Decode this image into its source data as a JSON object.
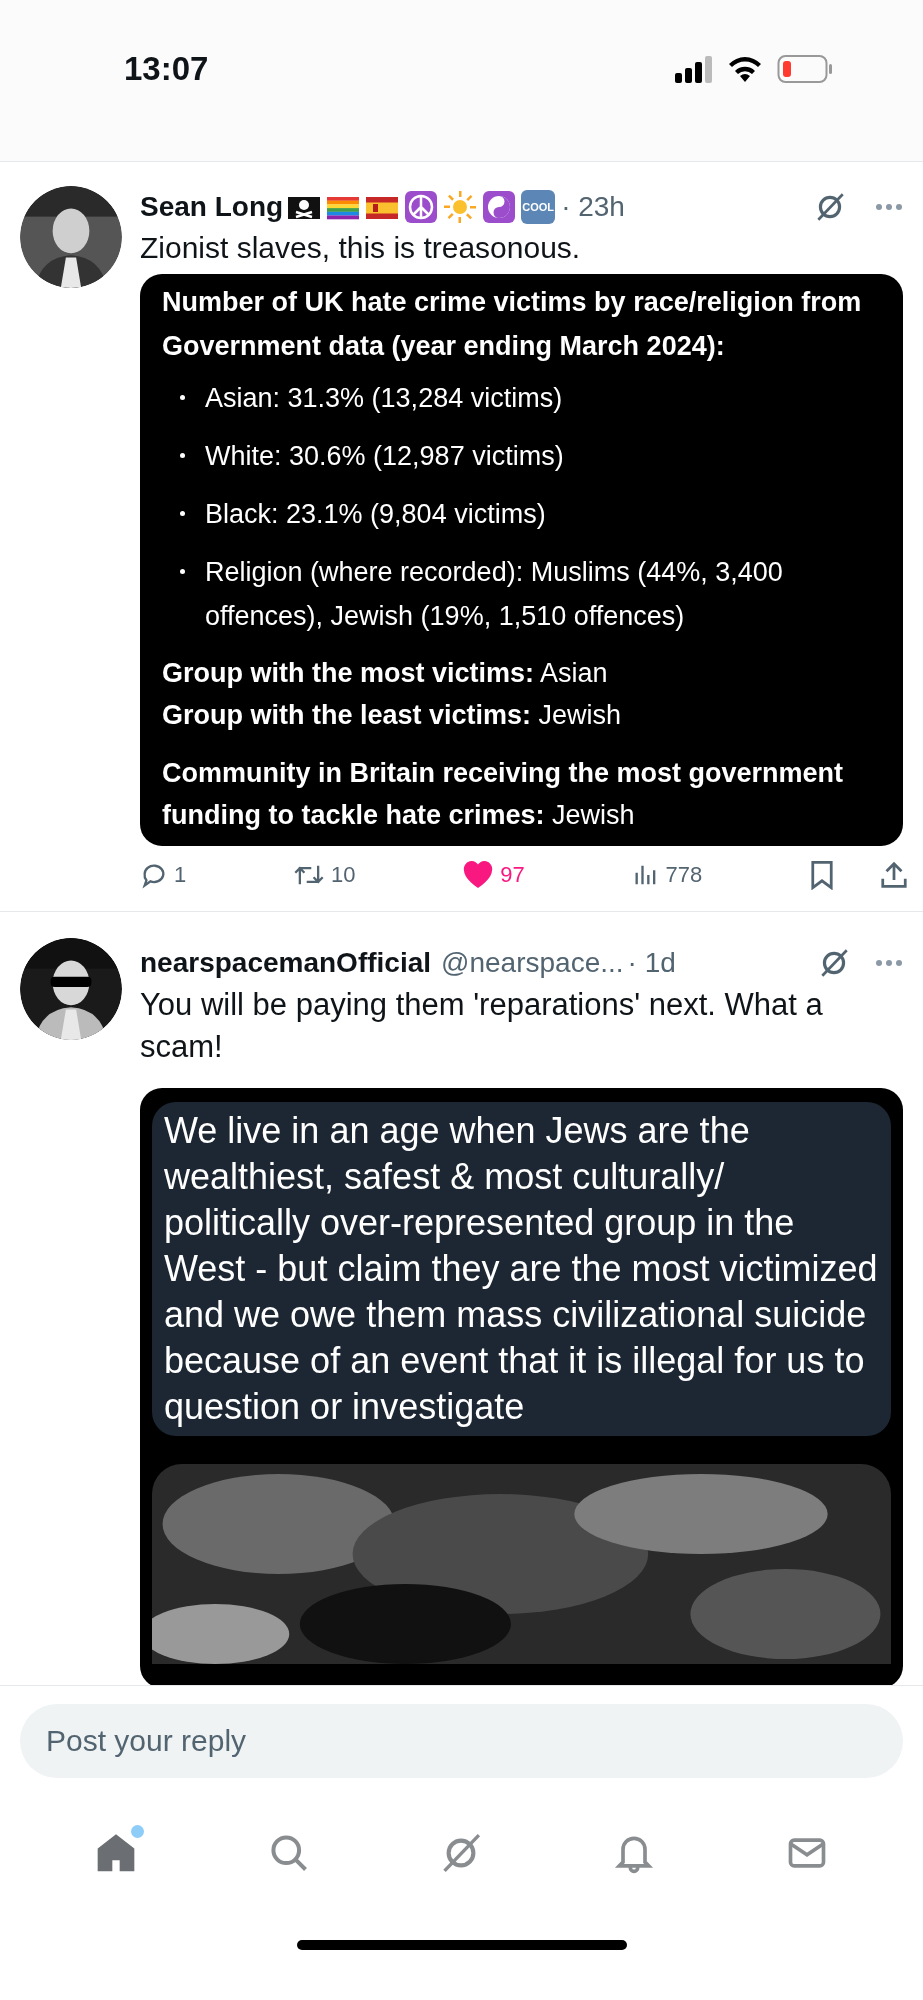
{
  "status_bar": {
    "time": "13:07"
  },
  "posts": [
    {
      "name": "Sean Long",
      "name_emoji": [
        {
          "kind": "pirate_flag"
        },
        {
          "kind": "rainbow_flag"
        },
        {
          "kind": "spain_flag"
        },
        {
          "kind": "peace"
        },
        {
          "kind": "sun"
        },
        {
          "kind": "yin_yang"
        },
        {
          "kind": "cool",
          "label": "COOL"
        }
      ],
      "time": "· 23h",
      "text": "Zionist slaves, this is treasonous.",
      "media": {
        "kind": "text_card",
        "title": "Number of UK hate crime victims by race/religion from Government data (year ending March 2024):",
        "bullets": [
          "Asian: 31.3% (13,284 victims)",
          "White: 30.6% (12,987 victims)",
          "Black: 23.1% (9,804 victims)",
          "Religion (where recorded): Muslims (44%, 3,400 offences), Jewish (19%, 1,510 offences)"
        ],
        "lines": [
          "**Group with the most victims:** Asian",
          "**Group with the least victims:** Jewish"
        ],
        "footer": "**Community in Britain receiving the most government funding to tackle hate crimes:** Jewish"
      },
      "actions": {
        "replies": "1",
        "reposts": "10",
        "likes": "97",
        "liked": true,
        "views": "778"
      }
    },
    {
      "name": "nearspacemanOfficial",
      "handle": "@nearspace...",
      "time": "· 1d",
      "text": "You will be paying them 'reparations' next. What a scam!",
      "media": {
        "kind": "quote_image",
        "quote": "We live in an age when Jews are the wealthiest, safest & most culturally/ politically over-represented group in the West - but claim they are the most victimized and we owe them mass civilizational suicide because of an event that it is illegal for us to question or investigate"
      }
    }
  ],
  "reply": {
    "placeholder": "Post your reply"
  },
  "tab_bar": {
    "items": [
      {
        "kind": "home",
        "selected": true,
        "badge": true
      },
      {
        "kind": "search",
        "selected": false
      },
      {
        "kind": "grok",
        "selected": false
      },
      {
        "kind": "bell",
        "selected": false
      },
      {
        "kind": "mail",
        "selected": false
      }
    ]
  }
}
